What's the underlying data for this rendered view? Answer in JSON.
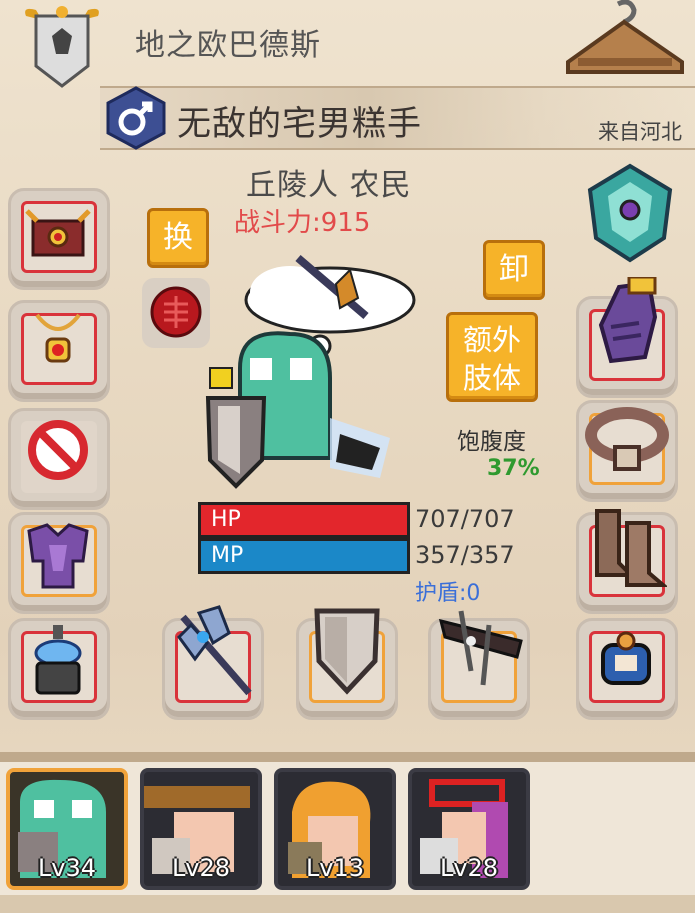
{
  "header": {
    "world_name": "地之欧巴德斯",
    "character_name": "无敌的宅男糕手",
    "origin": "来自河北",
    "gender_icon": "male-icon"
  },
  "profile": {
    "race_class": "丘陵人 农民",
    "combat_power": "战斗力:915"
  },
  "buttons": {
    "swap": "换",
    "unequip": "卸",
    "extra_limb": "额外\n肢体"
  },
  "satiety": {
    "label": "饱腹度",
    "value": "37%"
  },
  "stats": {
    "hp_label": "HP",
    "hp_value": "707/707",
    "hp_fraction": 1.0,
    "mp_label": "MP",
    "mp_value": "357/357",
    "mp_fraction": 1.0,
    "shield": "护盾:0"
  },
  "colors": {
    "hp": "#e3262c",
    "mp": "#1b88c8",
    "accent": "#f6b329",
    "satiety": "#2f9a2f",
    "power": "#e24a4a"
  },
  "party": [
    {
      "level": "Lv34",
      "selected": true
    },
    {
      "level": "Lv28",
      "selected": false
    },
    {
      "level": "Lv13",
      "selected": false
    },
    {
      "level": "Lv28",
      "selected": false
    }
  ],
  "equipment_left": [
    "helmet-icon",
    "amulet-icon",
    "forbidden-icon",
    "armor-icon",
    "lamp-icon"
  ],
  "equipment_right": [
    "emblem-icon",
    "gauntlet-icon",
    "belt-icon",
    "boots-icon",
    "ring-icon"
  ],
  "equipment_bottom": [
    "battle-axe-icon",
    "shield-icon",
    "crossbow-icon"
  ]
}
